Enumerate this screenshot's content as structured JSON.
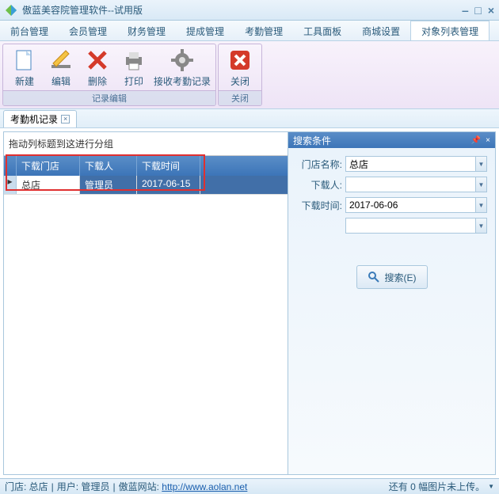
{
  "window": {
    "title": "傲蓝美容院管理软件--试用版"
  },
  "menu": {
    "items": [
      "前台管理",
      "会员管理",
      "财务管理",
      "提成管理",
      "考勤管理",
      "工具面板",
      "商城设置",
      "对象列表管理"
    ],
    "active": 7
  },
  "ribbon": {
    "group1": {
      "title": "记录编辑",
      "new": "新建",
      "edit": "编辑",
      "delete": "删除",
      "print": "打印",
      "receive": "接收考勤记录"
    },
    "group2": {
      "title": "关闭",
      "close": "关闭"
    }
  },
  "tab": {
    "label": "考勤机记录"
  },
  "grid": {
    "groupHint": "拖动列标题到这进行分组",
    "cols": [
      "下载门店",
      "下载人",
      "下载时间"
    ],
    "row": {
      "c1": "总店",
      "c2": "管理员",
      "c3": "2017-06-15"
    }
  },
  "search": {
    "panelTitle": "搜索条件",
    "storeLabel": "门店名称:",
    "storeValue": "总店",
    "userLabel": "下载人:",
    "userValue": "",
    "timeLabel": "下载时间:",
    "timeValue": "2017-06-06",
    "extraValue": "",
    "btn": "搜索(E)"
  },
  "status": {
    "left1": "门店: 总店",
    "left2": "用户: 管理员",
    "siteLabel": "傲蓝网站:",
    "url": "http://www.aolan.net",
    "right": "还有 0 幅图片未上传。"
  }
}
